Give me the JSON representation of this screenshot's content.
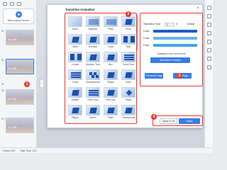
{
  "sidebar": {
    "new_layout_label": "New Layout Scene",
    "slides": [
      {
        "num": "01",
        "title": "No Title"
      },
      {
        "num": "02",
        "title": "No Title"
      },
      {
        "num": "03",
        "title": "No Title"
      },
      {
        "num": "04",
        "title": "No Title"
      }
    ]
  },
  "dialog": {
    "title": "Transition Animation",
    "effects": [
      "None",
      "Dissolve",
      "Fade",
      "Push",
      "Wipe",
      "Uncover",
      "Cover",
      "Split",
      "Curtain",
      "Airplane Tran",
      "Box",
      "Comb Tran",
      "Comb",
      "Checkerboard",
      "Shape",
      "Cube",
      "Gallery",
      "Grid Lines",
      "Fall Over",
      "Heart",
      "Ripple",
      "Vortex",
      "Flash",
      "Honeycomb"
    ],
    "settings": {
      "time_label": "Transition Time",
      "time_value": "2",
      "time_unit": "S",
      "default_label": "Default",
      "color1_label": "Color",
      "color2_label": "Color",
      "color3_label": "Color",
      "color1": "#1e5bc6",
      "color2": "#6aaee8",
      "color3": "#3fa7e0",
      "apply_text": "Autoplay to the next scene",
      "preview_label": "Animation Preview",
      "previous_label": "Previous Page",
      "next_label": "Next Page"
    },
    "footer": {
      "apply_all_label": "Apply to All",
      "apply_label": "Apply"
    }
  },
  "markers": [
    "1",
    "2",
    "3",
    "4"
  ],
  "status": {
    "frame": "Frame 2/20",
    "total_time": "Total Time: 12S"
  },
  "accent_color": "#3b7de0",
  "highlight_color": "#e53935"
}
